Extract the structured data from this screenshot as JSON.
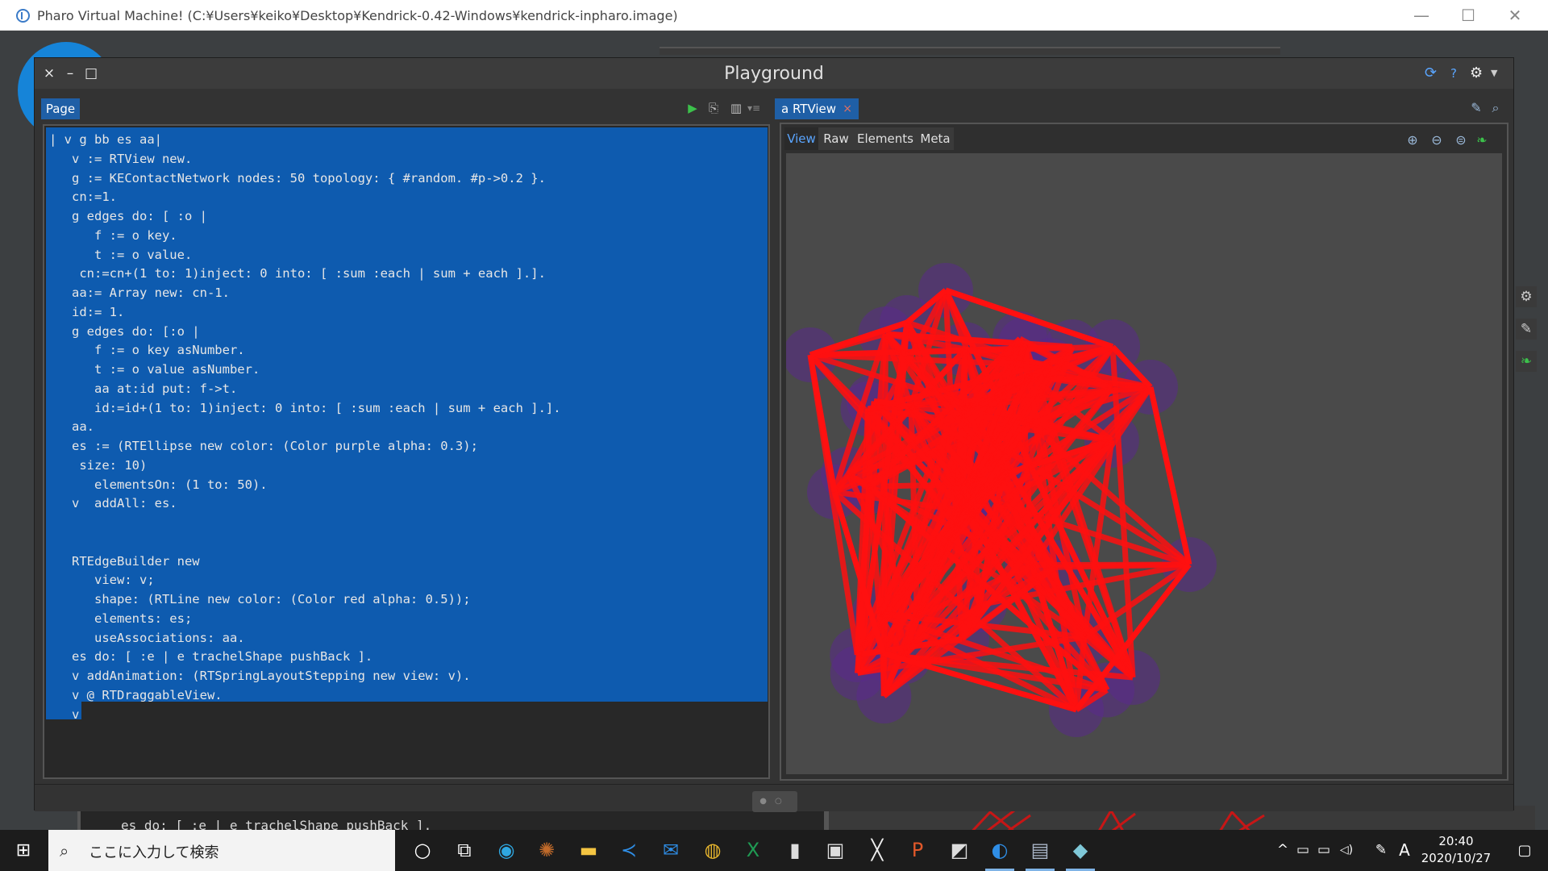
{
  "window": {
    "title": "Pharo Virtual Machine! (C:¥Users¥keiko¥Desktop¥Kendrick-0.42-Windows¥kendrick-inpharo.image)",
    "minimize": "—",
    "maximize": "☐",
    "close": "✕"
  },
  "playground": {
    "title": "Playground",
    "close": "×",
    "minimize": "–",
    "maximize": "□",
    "left_tab": "Page",
    "right_tab": "a RTView",
    "right_tab_close": "×",
    "subtabs": [
      "View",
      "Raw",
      "Elements",
      "Meta"
    ]
  },
  "code": {
    "lines": [
      "| v g bb es aa|",
      "   v := RTView new.",
      "   g := KEContactNetwork nodes: 50 topology: { #random. #p->0.2 }.",
      "   cn:=1.",
      "   g edges do: [ :o |",
      "      f := o key.",
      "      t := o value.",
      "    cn:=cn+(1 to: 1)inject: 0 into: [ :sum :each | sum + each ].].",
      "   aa:= Array new: cn-1.",
      "   id:= 1.",
      "   g edges do: [:o |",
      "      f := o key asNumber.",
      "      t := o value asNumber.",
      "      aa at:id put: f->t.",
      "      id:=id+(1 to: 1)inject: 0 into: [ :sum :each | sum + each ].].",
      "   aa.",
      "   es := (RTEllipse new color: (Color purple alpha: 0.3);",
      "    size: 10)",
      "      elementsOn: (1 to: 50).",
      "   v  addAll: es.",
      "",
      "",
      "   RTEdgeBuilder new",
      "      view: v;",
      "      shape: (RTLine new color: (Color red alpha: 0.5));",
      "      elements: es;",
      "      useAssociations: aa.",
      "   es do: [ :e | e trachelShape pushBack ].",
      "   v addAnimation: (RTSpringLayoutStepping new view: v).",
      "   v @ RTDraggableView.",
      "   v"
    ]
  },
  "background": {
    "bottom_code": "es do: [ :e | e trachelShape pushBack ].",
    "bottom_dots": "·· ··· ·· ··· ·· ··· ··· ·· ··· ··"
  },
  "taskbar": {
    "start": "⊞",
    "search_icon": "⌕",
    "search_placeholder": "ここに入力して検索",
    "apps": [
      {
        "name": "cortana-icon",
        "glyph": "○",
        "color": "#ffffff"
      },
      {
        "name": "task-view-icon",
        "glyph": "⧉",
        "color": "#ffffff"
      },
      {
        "name": "edge-icon",
        "glyph": "◉",
        "color": "#2fa7e0"
      },
      {
        "name": "paint-icon",
        "glyph": "✺",
        "color": "#c06a2a"
      },
      {
        "name": "explorer-icon",
        "glyph": "▬",
        "color": "#f4c542"
      },
      {
        "name": "vscode-icon",
        "glyph": "≺",
        "color": "#2f8ee6"
      },
      {
        "name": "mail-icon",
        "glyph": "✉",
        "color": "#2f8ee6"
      },
      {
        "name": "chrome-icon",
        "glyph": "◍",
        "color": "#e8b62e"
      },
      {
        "name": "excel-icon",
        "glyph": "X",
        "color": "#1f9a53"
      },
      {
        "name": "notes-icon",
        "glyph": "▮",
        "color": "#dddddd"
      },
      {
        "name": "store-icon",
        "glyph": "▣",
        "color": "#dddddd"
      },
      {
        "name": "x-app-icon",
        "glyph": "╳",
        "color": "#eeeeee"
      },
      {
        "name": "powerpoint-icon",
        "glyph": "P",
        "color": "#e0582a"
      },
      {
        "name": "clip-icon",
        "glyph": "◩",
        "color": "#dddddd"
      },
      {
        "name": "pharo-icon",
        "glyph": "◐",
        "color": "#2f8ee6"
      },
      {
        "name": "vm-icon",
        "glyph": "▤",
        "color": "#aab6c8"
      },
      {
        "name": "eraser-icon",
        "glyph": "◆",
        "color": "#7fc8d8"
      }
    ],
    "tray_up": "^",
    "tray_battery": "▭",
    "tray_network": "▭",
    "tray_volume": "◁)",
    "tray_pen": "✎",
    "ime": "A",
    "time": "20:40",
    "date": "2020/10/27",
    "notifications": "▢"
  }
}
